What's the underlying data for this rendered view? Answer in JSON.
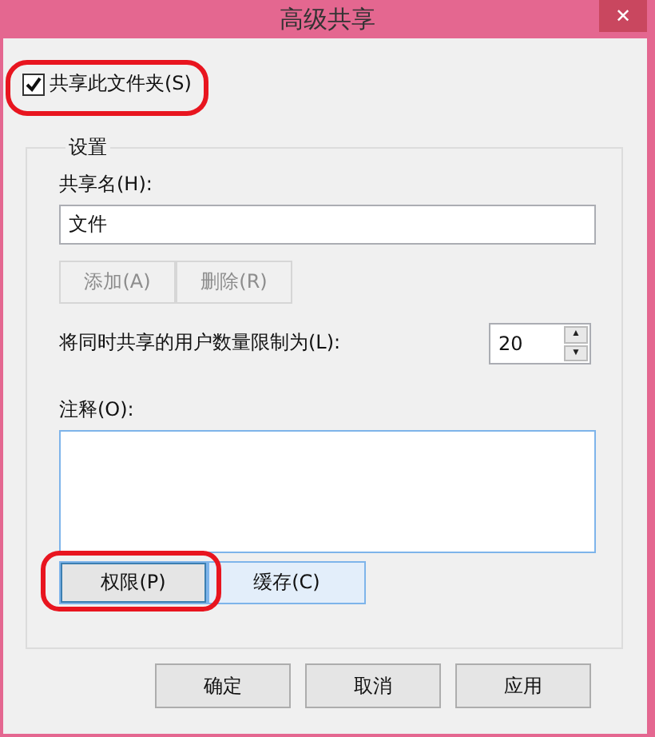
{
  "window": {
    "title": "高级共享",
    "close": "✕"
  },
  "share_checkbox": {
    "label": "共享此文件夹(S)",
    "checked": true
  },
  "settings": {
    "legend": "设置",
    "share_name_label": "共享名(H):",
    "share_name_value": "文件",
    "name_buttons": [
      {
        "label": "添加(A)",
        "disabled": true
      },
      {
        "label": "删除(R)",
        "disabled": true
      }
    ],
    "limit_label": "将同时共享的用户数量限制为(L):",
    "limit_value": "20",
    "spin_up": "▲",
    "spin_down": "▼",
    "comment_label": "注释(O):",
    "buttons": [
      {
        "label": "权限(P)",
        "focused": true,
        "highlighted": false
      },
      {
        "label": "缓存(C)",
        "focused": false,
        "highlighted": true
      }
    ]
  },
  "footer_buttons": [
    {
      "label": "确定",
      "disabled": false
    },
    {
      "label": "取消",
      "disabled": false
    },
    {
      "label": "应用",
      "disabled": false
    }
  ]
}
